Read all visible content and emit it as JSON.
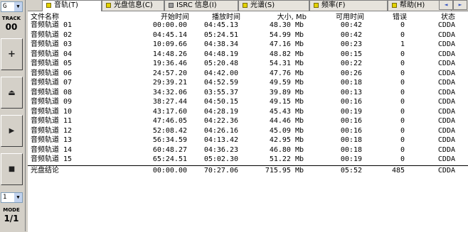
{
  "left_panel": {
    "drive": "G",
    "track_label": "TRACK",
    "track_value": "00",
    "buttons": [
      "+",
      "⏏",
      "▶",
      "■"
    ],
    "speed": "1",
    "mode_label": "MODE",
    "mode_value": "1/1"
  },
  "tabs": [
    {
      "label": "音轨(T)",
      "flag": "yellow"
    },
    {
      "label": "光盘信息(C)",
      "flag": "yellow"
    },
    {
      "label": "ISRC 信息(I)",
      "flag": "grey"
    },
    {
      "label": "光谱(S)",
      "flag": "yellow"
    },
    {
      "label": "频率(F)",
      "flag": "yellow"
    },
    {
      "label": "帮助(H)",
      "flag": "yellow"
    }
  ],
  "scroll_arrows": [
    "◄",
    "►"
  ],
  "table": {
    "headers": {
      "name": "文件名称",
      "start": "开始时间",
      "play": "播放时间",
      "size": "大小, Mb",
      "avail": "可用时间",
      "err": "错误",
      "stat": "状态"
    },
    "rows": [
      {
        "name": "音频轨道 01",
        "start": "00:00.00",
        "play": "04:45.13",
        "size": "48.30 Mb",
        "avail": "00:42",
        "err": "0",
        "stat": "CDDA"
      },
      {
        "name": "音频轨道 02",
        "start": "04:45.14",
        "play": "05:24.51",
        "size": "54.99 Mb",
        "avail": "00:42",
        "err": "0",
        "stat": "CDDA"
      },
      {
        "name": "音频轨道 03",
        "start": "10:09.66",
        "play": "04:38.34",
        "size": "47.16 Mb",
        "avail": "00:23",
        "err": "1",
        "stat": "CDDA"
      },
      {
        "name": "音频轨道 04",
        "start": "14:48.26",
        "play": "04:48.19",
        "size": "48.82 Mb",
        "avail": "00:15",
        "err": "0",
        "stat": "CDDA"
      },
      {
        "name": "音频轨道 05",
        "start": "19:36.46",
        "play": "05:20.48",
        "size": "54.31 Mb",
        "avail": "00:22",
        "err": "0",
        "stat": "CDDA"
      },
      {
        "name": "音频轨道 06",
        "start": "24:57.20",
        "play": "04:42.00",
        "size": "47.76 Mb",
        "avail": "00:26",
        "err": "0",
        "stat": "CDDA"
      },
      {
        "name": "音频轨道 07",
        "start": "29:39.21",
        "play": "04:52.59",
        "size": "49.59 Mb",
        "avail": "00:18",
        "err": "0",
        "stat": "CDDA"
      },
      {
        "name": "音频轨道 08",
        "start": "34:32.06",
        "play": "03:55.37",
        "size": "39.89 Mb",
        "avail": "00:13",
        "err": "0",
        "stat": "CDDA"
      },
      {
        "name": "音频轨道 09",
        "start": "38:27.44",
        "play": "04:50.15",
        "size": "49.15 Mb",
        "avail": "00:16",
        "err": "0",
        "stat": "CDDA"
      },
      {
        "name": "音频轨道 10",
        "start": "43:17.60",
        "play": "04:28.19",
        "size": "45.43 Mb",
        "avail": "00:19",
        "err": "0",
        "stat": "CDDA"
      },
      {
        "name": "音频轨道 11",
        "start": "47:46.05",
        "play": "04:22.36",
        "size": "44.46 Mb",
        "avail": "00:16",
        "err": "0",
        "stat": "CDDA"
      },
      {
        "name": "音频轨道 12",
        "start": "52:08.42",
        "play": "04:26.16",
        "size": "45.09 Mb",
        "avail": "00:16",
        "err": "0",
        "stat": "CDDA"
      },
      {
        "name": "音频轨道 13",
        "start": "56:34.59",
        "play": "04:13.42",
        "size": "42.95 Mb",
        "avail": "00:18",
        "err": "0",
        "stat": "CDDA"
      },
      {
        "name": "音频轨道 14",
        "start": "60:48.27",
        "play": "04:36.23",
        "size": "46.80 Mb",
        "avail": "00:18",
        "err": "0",
        "stat": "CDDA"
      },
      {
        "name": "音频轨道 15",
        "start": "65:24.51",
        "play": "05:02.30",
        "size": "51.22 Mb",
        "avail": "00:19",
        "err": "0",
        "stat": "CDDA"
      }
    ],
    "summary": {
      "name": "光盘结论",
      "start": "00:00.00",
      "play": "70:27.06",
      "size": "715.95 Mb",
      "avail": "05:52",
      "err": "485",
      "stat": "CDDA"
    }
  }
}
